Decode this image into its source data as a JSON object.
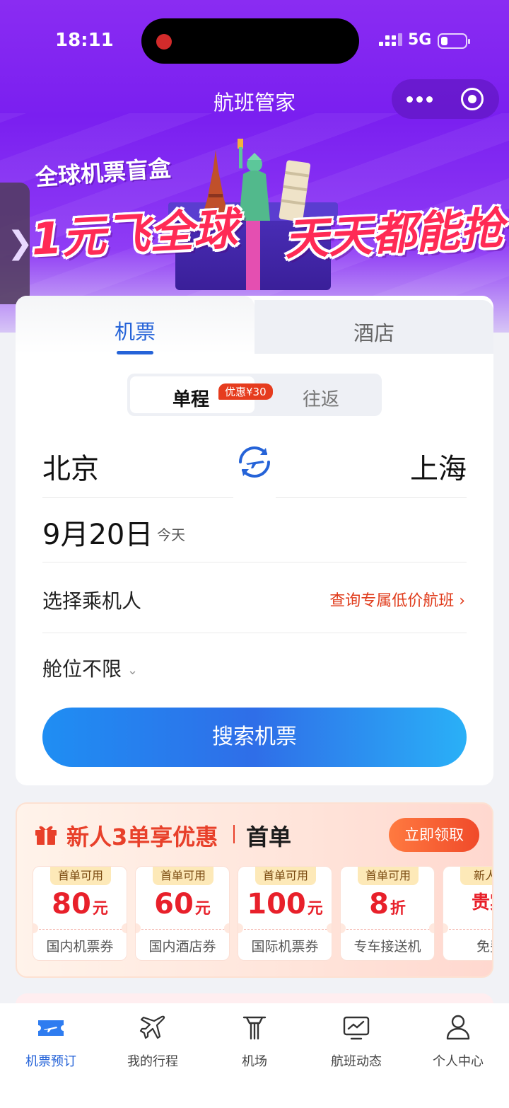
{
  "status_bar": {
    "time": "18:11",
    "network": "5G"
  },
  "header": {
    "title": "航班管家"
  },
  "banner": {
    "subtitle": "全球机票盲盒",
    "headline_left": "1元飞全球",
    "headline_right": "天天都能抢"
  },
  "side_tab": {
    "glyph": "❯"
  },
  "booking": {
    "tabs": [
      {
        "label": "机票",
        "active": true
      },
      {
        "label": "酒店",
        "active": false
      }
    ],
    "trip_types": {
      "single": "单程",
      "single_badge": "优惠¥30",
      "round": "往返"
    },
    "from_city": "北京",
    "to_city": "上海",
    "date": "9月20日",
    "date_hint": "今天",
    "passenger": "选择乘机人",
    "low_price_link": "查询专属低价航班 ›",
    "cabin": "舱位不限",
    "search_button": "搜索机票"
  },
  "promo": {
    "title": "新人3单享优惠",
    "title2": "首单",
    "claim_button": "立即领取",
    "coupons": [
      {
        "tag": "首单可用",
        "value": "80",
        "unit": "元",
        "desc": "国内机票券"
      },
      {
        "tag": "首单可用",
        "value": "60",
        "unit": "元",
        "desc": "国内酒店券"
      },
      {
        "tag": "首单可用",
        "value": "100",
        "unit": "元",
        "desc": "国际机票券"
      },
      {
        "tag": "首单可用",
        "value": "8",
        "unit": "折",
        "desc": "专车接送机"
      },
      {
        "tag": "新人限",
        "value": "贵宾",
        "unit": "",
        "desc": "免费"
      }
    ]
  },
  "nav": {
    "items": [
      {
        "label": "机票预订",
        "icon": "ticket-icon",
        "active": true
      },
      {
        "label": "我的行程",
        "icon": "plane-icon",
        "active": false
      },
      {
        "label": "机场",
        "icon": "airport-icon",
        "active": false
      },
      {
        "label": "航班动态",
        "icon": "monitor-icon",
        "active": false
      },
      {
        "label": "个人中心",
        "icon": "person-icon",
        "active": false
      }
    ]
  },
  "colors": {
    "accent": "#2563d8",
    "promo_red": "#e8402a",
    "header_purple": "#7a1ff0"
  }
}
